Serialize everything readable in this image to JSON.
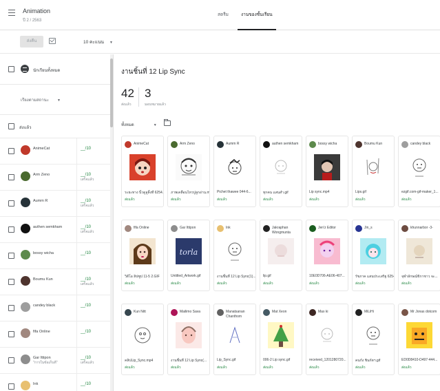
{
  "header": {
    "title": "Animation",
    "subtitle": "ปี 2 / 2563",
    "tabs": [
      "สตรีม",
      "งานของชั้นเรียน"
    ],
    "active_tab": 1
  },
  "toolbar": {
    "return_label": "ส่งคืน",
    "points_value": "10 คะแนน"
  },
  "left_panel": {
    "sort_label": "นักเรียนทั้งหมด",
    "status_filter": "เรียงตามสถานะ",
    "all_label": "ส่งแล้ว",
    "students": [
      {
        "name": "AnimeCat",
        "sub": "",
        "grade": "__/10",
        "grade_sub": "",
        "color": "#c0392b"
      },
      {
        "name": "Arm Zeno",
        "sub": "",
        "grade": "__/10",
        "grade_sub": "เสร็จแล้ว",
        "color": "#4a6a2f"
      },
      {
        "name": "Aumm R",
        "sub": "",
        "grade": "__/10",
        "grade_sub": "เสร็จแล้ว",
        "color": "#263238"
      },
      {
        "name": "authen semkham",
        "sub": "",
        "grade": "__/10",
        "grade_sub": "เสร็จแล้ว",
        "color": "#111111"
      },
      {
        "name": "bossy wicha",
        "sub": "",
        "grade": "__/10",
        "grade_sub": "",
        "color": "#5d8a4c"
      },
      {
        "name": "Boumu Kun",
        "sub": "",
        "grade": "__/10",
        "grade_sub": "เสร็จแล้ว",
        "color": "#4e342e"
      },
      {
        "name": "candey black",
        "sub": "",
        "grade": "__/10",
        "grade_sub": "",
        "color": "#9e9e9e"
      },
      {
        "name": "fifa Online",
        "sub": "",
        "grade": "__/10",
        "grade_sub": "",
        "color": "#a1887f"
      },
      {
        "name": "Gar Ittipon",
        "sub": "\"การในข้อเก็บดี\"",
        "grade": "__/10",
        "grade_sub": "เสร็จแล้ว",
        "color": "#8d8d8d"
      },
      {
        "name": "Ink",
        "sub": "",
        "grade": "__/10",
        "grade_sub": "",
        "color": "#e8c070"
      }
    ]
  },
  "assignment": {
    "title": "งานชิ้นที่ 12 Lip Sync",
    "turned_in_count": "42",
    "turned_in_label": "ส่งแล้ว",
    "assigned_count": "3",
    "assigned_label": "มอบหมายแล้ว",
    "filter_label": "ทั้งหมด"
  },
  "submissions": [
    {
      "name": "AnimeCat",
      "file": "ระยะทาง นิ้วดูลูลิ้งที่ 6254...",
      "status": "ส่งแล้ว",
      "avatar": "#c0392b",
      "art": "redhead"
    },
    {
      "name": "Arm Zeno",
      "file": "ภาพเคลื่อนไหวปูลูกอ่าน.mov",
      "status": "ส่งแล้ว",
      "avatar": "#4a6a2f",
      "art": "sketch"
    },
    {
      "name": "Aumm R",
      "file": "Pichet thawee 044-6...",
      "status": "ส่งแล้ว",
      "avatar": "#263238",
      "art": "boy"
    },
    {
      "name": "authen semkham",
      "file": "ทุกคน แสนสำ.gif",
      "status": "ส่งแล้ว",
      "avatar": "#111111",
      "art": "faint"
    },
    {
      "name": "bossy wicha",
      "file": "Lip sync.mp4",
      "status": "ส่งแล้ว",
      "avatar": "#5d8a4c",
      "art": "dark"
    },
    {
      "name": "Boumu Kun",
      "file": "Lips.gif",
      "status": "ส่งแล้ว",
      "avatar": "#4e342e",
      "art": "doodle"
    },
    {
      "name": "candey black",
      "file": "ezgif.com-gif-maker_1...",
      "status": "ส่งแล้ว",
      "avatar": "#9e9e9e",
      "art": "line"
    },
    {
      "name": "fifa Online",
      "file": "วิดีโอ ลิปซูป 11-5 2.GIF",
      "status": "ส่งแล้ว",
      "avatar": "#a1887f",
      "art": "girl"
    },
    {
      "name": "Gar Ittipon",
      "file": "Untitled_Artwork.gif",
      "status": "ส่งแล้ว",
      "avatar": "#8d8d8d",
      "art": "lettering"
    },
    {
      "name": "Ink",
      "file": "งานชิ้นที่ 12 Lip Sync(1)...",
      "status": "ส่งแล้ว",
      "avatar": "#e8c070",
      "art": "line"
    },
    {
      "name": "Jakraphan Wongmunta",
      "file": "lip.gif",
      "status": "ส่งแล้ว",
      "avatar": "#222222",
      "art": "pale"
    },
    {
      "name": "Jen'z Editor",
      "file": "10E0D706-AE06-407...",
      "status": "ส่งแล้ว",
      "avatar": "#1b5e20",
      "art": "pink"
    },
    {
      "name": "Jin_s",
      "file": "รัชภาค แสนประเสริฐ 6254...",
      "status": "ส่งแล้ว",
      "avatar": "#283593",
      "art": "teal"
    },
    {
      "name": "khunnarbor -3-",
      "file": "จุฬาลักษณ์ขิกาชาว จะ...",
      "status": "ส่งแล้ว",
      "avatar": "#6d4c41",
      "art": "beige"
    },
    {
      "name": "Kun Nitt",
      "file": "คลิปLip_Sync.mp4",
      "status": "ส่งแล้ว",
      "avatar": "#37474f",
      "art": "circle"
    },
    {
      "name": "Mailimo Sava",
      "file": "งานชิ้นที่ 12 Lip Sync(...",
      "status": "ส่งแล้ว",
      "avatar": "#ad1457",
      "art": "blush"
    },
    {
      "name": "Manatsanan Chanthom",
      "file": "Lip_Sync.gif",
      "status": "ส่งแล้ว",
      "avatar": "#616161",
      "art": "blueline"
    },
    {
      "name": "Mat Xeon",
      "file": "006-2 Lip sync.gif",
      "status": "ส่งแล้ว",
      "avatar": "#455a64",
      "art": "tree"
    },
    {
      "name": "Max ki",
      "file": "received_1201280720...",
      "status": "ส่งแล้ว",
      "avatar": "#3e2723",
      "art": "faint"
    },
    {
      "name": "MiLiHi",
      "file": "คนกัง ชินกัตฯ.gif",
      "status": "ส่งแล้ว",
      "avatar": "#212121",
      "art": "line"
    },
    {
      "name": "Mr Jonas dotcom",
      "file": "ED0D8410-D497-444...",
      "status": "ส่งแล้ว",
      "avatar": "#795548",
      "art": "yellow"
    }
  ]
}
